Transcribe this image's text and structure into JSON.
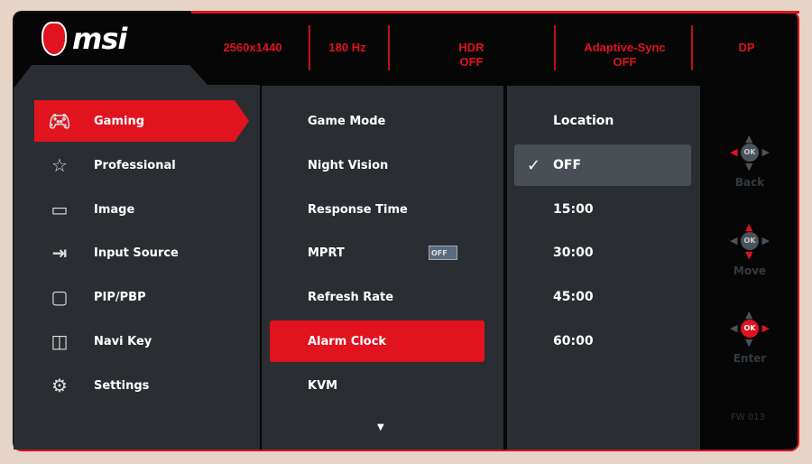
{
  "brand": "msi",
  "status": [
    {
      "label": "2560x1440"
    },
    {
      "label": "180 Hz"
    },
    {
      "label": "HDR",
      "value": "OFF"
    },
    {
      "label": "Adaptive-Sync",
      "value": "OFF"
    },
    {
      "label": "DP"
    }
  ],
  "menu": [
    {
      "label": "Gaming",
      "icon": "gamepad-icon"
    },
    {
      "label": "Professional",
      "icon": "star-icon"
    },
    {
      "label": "Image",
      "icon": "image-icon"
    },
    {
      "label": "Input Source",
      "icon": "input-icon"
    },
    {
      "label": "PIP/PBP",
      "icon": "pip-icon"
    },
    {
      "label": "Navi Key",
      "icon": "navi-key-icon"
    },
    {
      "label": "Settings",
      "icon": "gear-icon"
    }
  ],
  "submenu": [
    {
      "label": "Game Mode"
    },
    {
      "label": "Night Vision"
    },
    {
      "label": "Response Time"
    },
    {
      "label": "MPRT",
      "toggle": "OFF"
    },
    {
      "label": "Refresh Rate"
    },
    {
      "label": "Alarm Clock"
    },
    {
      "label": "KVM"
    }
  ],
  "options": [
    {
      "label": "Location"
    },
    {
      "label": "OFF"
    },
    {
      "label": "15:00"
    },
    {
      "label": "30:00"
    },
    {
      "label": "45:00"
    },
    {
      "label": "60:00"
    }
  ],
  "nav": {
    "back": "Back",
    "move": "Move",
    "enter": "Enter",
    "ok": "OK"
  },
  "firmware": "FW 013",
  "colors": {
    "accent": "#e0131f",
    "panel": "#2a2d31"
  }
}
